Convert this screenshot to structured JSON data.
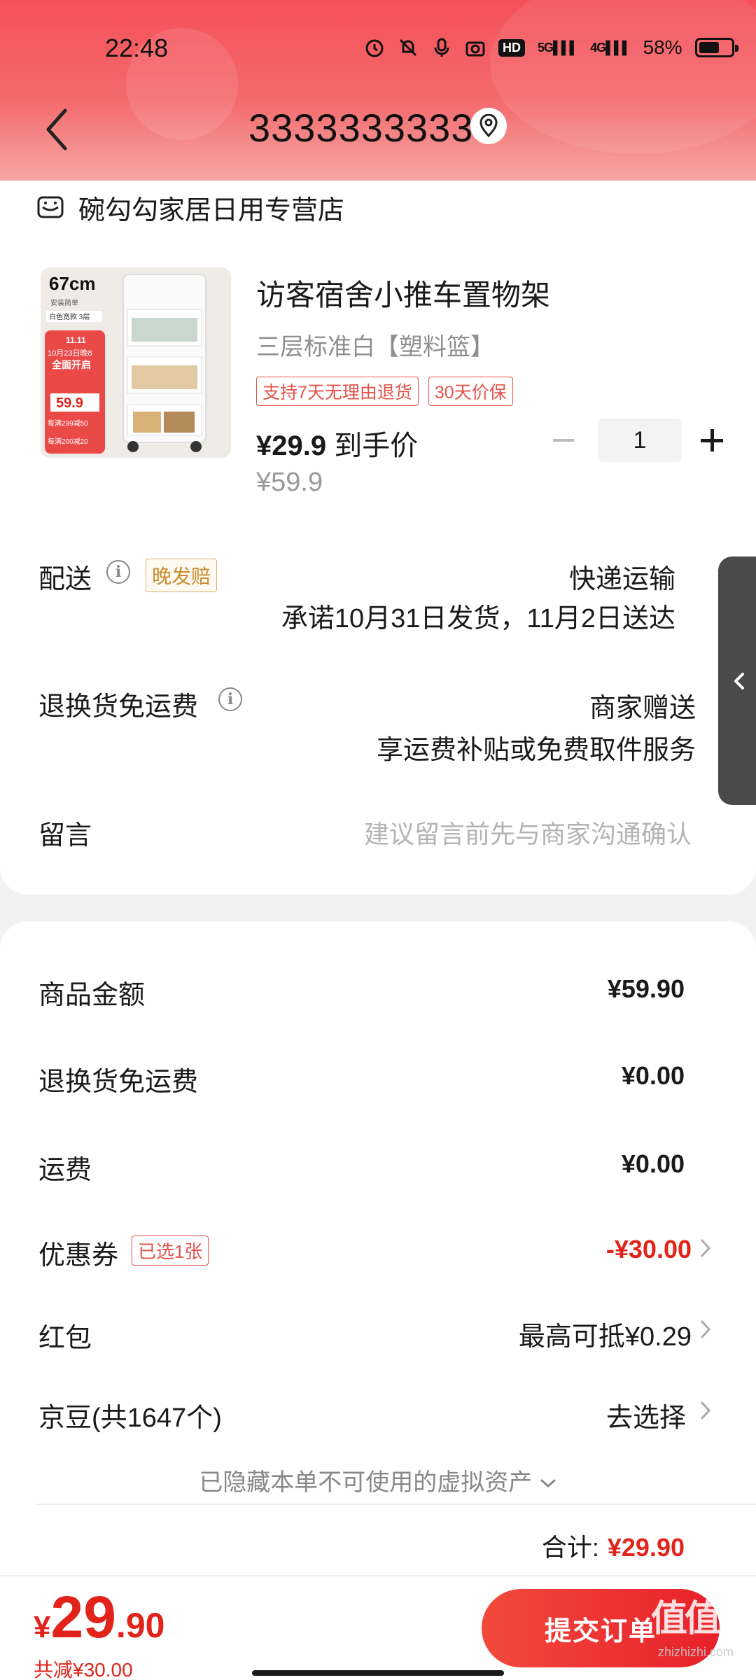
{
  "status_bar": {
    "time": "22:48",
    "network": "5G",
    "network2": "4G",
    "hd_label": "HD",
    "battery_text": "58%"
  },
  "nav": {
    "title": "3333333333"
  },
  "shop": {
    "name": "碗勾勾家居日用专营店"
  },
  "product": {
    "title": "访客宿舍小推车置物架",
    "spec": "三层标准白【塑料篮】",
    "tags": [
      "支持7天无理由退货",
      "30天价保"
    ],
    "price_label": "¥29.9",
    "price_suffix": " 到手价",
    "original_price": "¥59.9",
    "quantity": "1",
    "image_badges": {
      "size": "67cm",
      "install": "安装简单",
      "layers": "白色宽款  3层",
      "event": "11.11",
      "event_date": "10月23日晚8",
      "event_start": "全面开启",
      "promo_price": "59.9",
      "promo_1": "每满299减50",
      "promo_2": "每满200减20"
    }
  },
  "delivery": {
    "label": "配送",
    "late_tag": "晚发赔",
    "method": "快递运输",
    "promise": "承诺10月31日发货，11月2日送达"
  },
  "return_shipping": {
    "label": "退换货免运费",
    "value": "商家赠送",
    "desc": "享运费补贴或免费取件服务"
  },
  "message": {
    "label": "留言",
    "placeholder": "建议留言前先与商家沟通确认"
  },
  "summary": {
    "goods_label": "商品金额",
    "goods_value": "¥59.90",
    "return_label": "退换货免运费",
    "return_value": "¥0.00",
    "shipping_label": "运费",
    "shipping_value": "¥0.00",
    "coupon_label": "优惠券",
    "coupon_tag": "已选1张",
    "coupon_value": "-¥30.00",
    "redpacket_label": "红包",
    "redpacket_value": "最高可抵¥0.29",
    "jingdou_label": "京豆(共1647个)",
    "jingdou_value": "去选择",
    "hidden_assets": "已隐藏本单不可使用的虚拟资产",
    "total_label": "合计:",
    "total_value": "¥29.90"
  },
  "bottom_bar": {
    "currency": "¥",
    "price_int": "29",
    "price_dec": ".90",
    "saved": "共减¥30.00",
    "submit_label": "提交订单"
  },
  "watermark": {
    "mark": "值值值",
    "site": "zhizhizhi.com"
  },
  "colors": {
    "accent_red": "#e2231a",
    "header_gradient_top": "#f5505a",
    "late_tag": "#c98c2e"
  }
}
